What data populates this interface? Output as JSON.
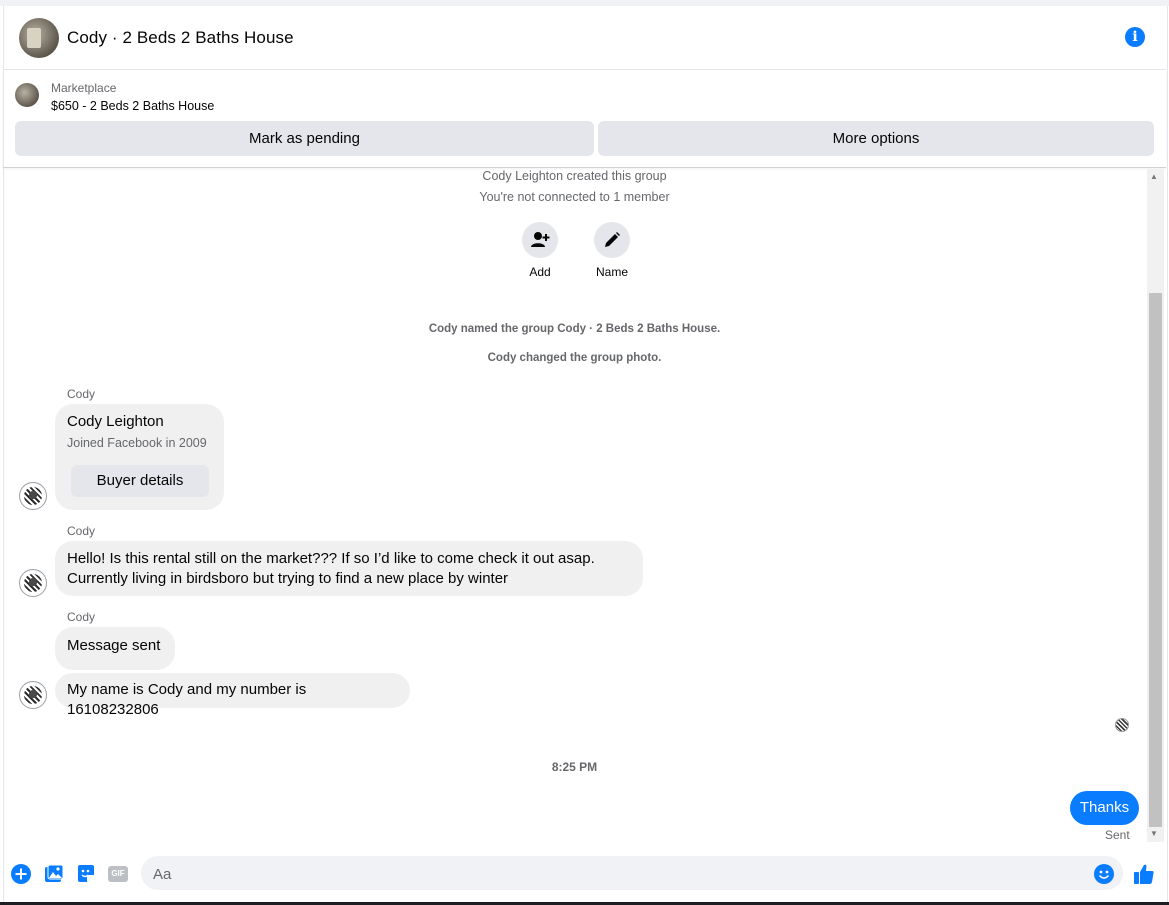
{
  "header": {
    "title": "Cody · 2 Beds 2 Baths House",
    "info_icon": "info-icon"
  },
  "marketplace": {
    "label": "Marketplace",
    "listing": "$650 - 2 Beds 2 Baths House",
    "pending_button": "Mark as pending",
    "more_button": "More options"
  },
  "system": {
    "created": "Cody Leighton created this group",
    "connected": "You're not connected to 1 member",
    "add_label": "Add",
    "name_label": "Name",
    "named": "Cody named the group Cody · 2 Beds 2 Baths House.",
    "photo": "Cody changed the group photo."
  },
  "messages": {
    "sender": "Cody",
    "card": {
      "name": "Cody Leighton",
      "joined": "Joined Facebook in 2009",
      "button": "Buyer details"
    },
    "msg1_line1": "Hello! Is this rental still on the market??? If so I’d like to come check it out asap.",
    "msg1_line2": "Currently living in birdsboro but trying to find a new place by winter",
    "msg2": "Message sent",
    "msg3": "My name is Cody and my number is 16108232806",
    "time": "8:25 PM",
    "my_msg": "Thanks",
    "status": "Sent"
  },
  "composer": {
    "placeholder": "Aa",
    "gif_label": "GIF"
  },
  "colors": {
    "accent": "#0a7cff",
    "bubble": "#f0f0f0",
    "button": "#e4e6eb"
  }
}
